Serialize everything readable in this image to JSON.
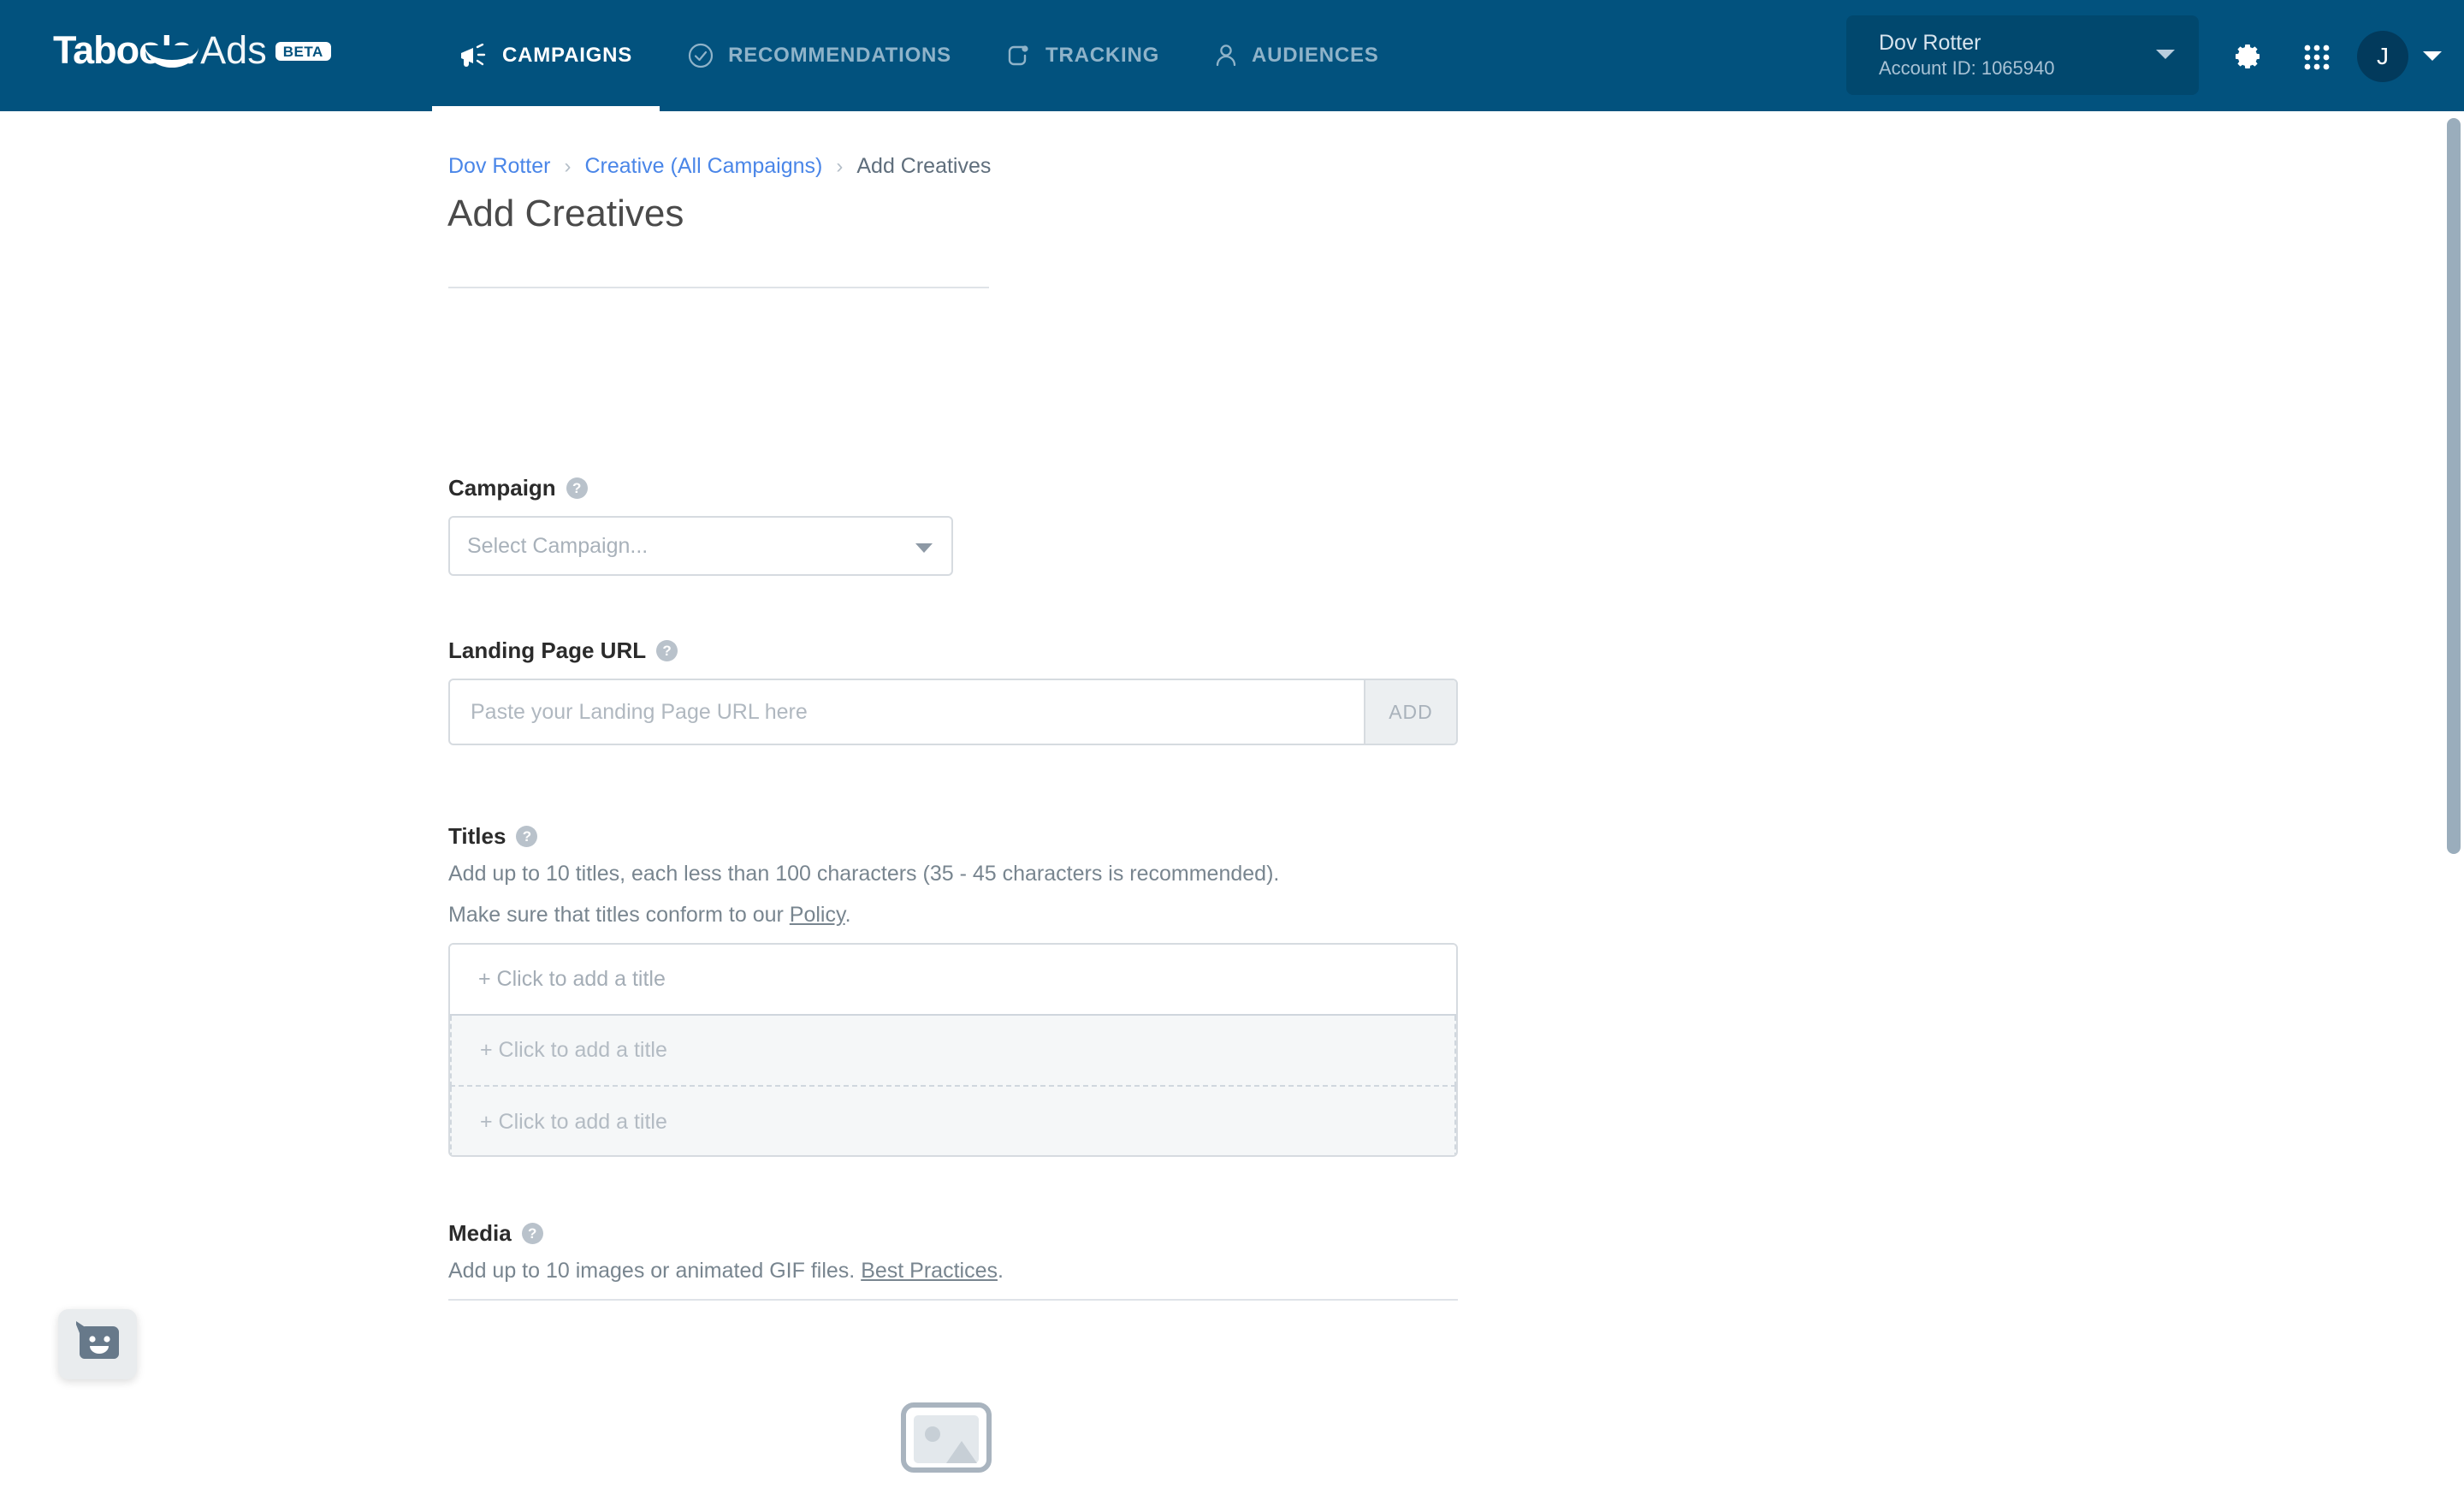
{
  "header": {
    "logo": {
      "brand_primary": "Taboola",
      "brand_secondary": "Ads",
      "badge": "BETA"
    },
    "tabs": [
      {
        "label": "CAMPAIGNS",
        "icon": "megaphone-icon",
        "active": true
      },
      {
        "label": "RECOMMENDATIONS",
        "icon": "check-circle-icon",
        "active": false
      },
      {
        "label": "TRACKING",
        "icon": "tracking-icon",
        "active": false
      },
      {
        "label": "AUDIENCES",
        "icon": "person-icon",
        "active": false
      }
    ],
    "account": {
      "name": "Dov Rotter",
      "id_label": "Account ID: 1065940"
    },
    "avatar_initial": "J",
    "icons": {
      "settings": "gear-icon",
      "apps": "apps-grid-icon"
    },
    "colors": {
      "background": "#02527e",
      "active_text": "#ffffff",
      "inactive_text": "#8fb3c9"
    }
  },
  "breadcrumb": {
    "items": [
      {
        "label": "Dov Rotter",
        "link": true
      },
      {
        "label": "Creative (All Campaigns)",
        "link": true
      },
      {
        "label": "Add Creatives",
        "link": false
      }
    ],
    "separator": "›"
  },
  "page": {
    "title": "Add Creatives"
  },
  "form": {
    "campaign": {
      "label": "Campaign",
      "help": "?",
      "select_value": "Select Campaign..."
    },
    "landing_page": {
      "label": "Landing Page URL",
      "help": "?",
      "input_value": "",
      "placeholder": "Paste your Landing Page URL here",
      "add_button": "ADD"
    },
    "titles": {
      "label": "Titles",
      "help": "?",
      "hint_line1": "Add up to 10 titles, each less than 100 characters (35 - 45 characters is recommended).",
      "hint_line2_prefix": "Make sure that titles conform to our ",
      "hint_line2_link": "Policy",
      "hint_line2_suffix": ".",
      "rows": [
        {
          "placeholder": "+ Click to add a title",
          "style": "active"
        },
        {
          "placeholder": "+ Click to add a title",
          "style": "ghost"
        },
        {
          "placeholder": "+ Click to add a title",
          "style": "ghost"
        }
      ]
    },
    "media": {
      "label": "Media",
      "help": "?",
      "hint_prefix": "Add up to 10 images or animated GIF files. ",
      "hint_link": "Best Practices",
      "hint_suffix": ".",
      "placeholder_icon": "image-placeholder-icon"
    }
  },
  "feedback_widget": {
    "icon": "feedback-smiley-icon"
  },
  "colors": {
    "brand_blue": "#02527e",
    "link_blue": "#4a86e8",
    "body_text": "#4a4a4a",
    "muted_text": "#78858f",
    "border": "#d6dbe0",
    "ghost_row_bg": "#f5f7f8"
  }
}
